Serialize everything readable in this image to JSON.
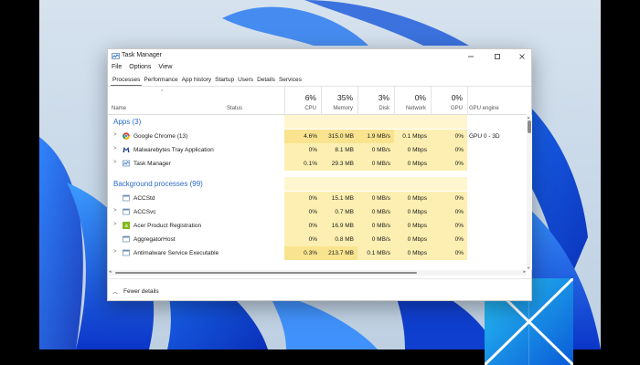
{
  "window": {
    "title": "Task Manager",
    "controls": {
      "minimize": "—",
      "maximize": "☐",
      "close": "✕"
    }
  },
  "menu": [
    "File",
    "Options",
    "View"
  ],
  "tabs": [
    {
      "label": "Processes",
      "active": true
    },
    {
      "label": "Performance",
      "active": false
    },
    {
      "label": "App history",
      "active": false
    },
    {
      "label": "Startup",
      "active": false
    },
    {
      "label": "Users",
      "active": false
    },
    {
      "label": "Details",
      "active": false
    },
    {
      "label": "Services",
      "active": false
    }
  ],
  "columns": {
    "name": "Name",
    "status": "Status",
    "cpu": {
      "pct": "6%",
      "label": "CPU"
    },
    "memory": {
      "pct": "35%",
      "label": "Memory"
    },
    "disk": {
      "pct": "3%",
      "label": "Disk"
    },
    "network": {
      "pct": "0%",
      "label": "Network"
    },
    "gpu": {
      "pct": "0%",
      "label": "GPU"
    },
    "gpu_engine": "GPU engine"
  },
  "groups": {
    "apps": "Apps (3)",
    "background": "Background processes (99)"
  },
  "apps": [
    {
      "name": "Google Chrome (13)",
      "icon": "chrome-icon",
      "cpu": "4.6%",
      "memory": "315.0 MB",
      "disk": "1.9 MB/s",
      "network": "0.1 Mbps",
      "gpu": "0%",
      "gpu_engine": "GPU 0 - 3D",
      "expandable": true
    },
    {
      "name": "Malwarebytes Tray Application",
      "icon": "malwarebytes-icon",
      "cpu": "0%",
      "memory": "8.1 MB",
      "disk": "0 MB/s",
      "network": "0 Mbps",
      "gpu": "0%",
      "gpu_engine": "",
      "expandable": true
    },
    {
      "name": "Task Manager",
      "icon": "task-manager-icon",
      "cpu": "0.1%",
      "memory": "29.3 MB",
      "disk": "0 MB/s",
      "network": "0 Mbps",
      "gpu": "0%",
      "gpu_engine": "",
      "expandable": true
    }
  ],
  "background": [
    {
      "name": "ACCStd",
      "icon": "app-window-icon",
      "cpu": "0%",
      "memory": "15.1 MB",
      "disk": "0 MB/s",
      "network": "0 Mbps",
      "gpu": "0%",
      "gpu_engine": "",
      "expandable": false
    },
    {
      "name": "ACCSvc",
      "icon": "app-window-icon",
      "cpu": "0%",
      "memory": "0.7 MB",
      "disk": "0 MB/s",
      "network": "0 Mbps",
      "gpu": "0%",
      "gpu_engine": "",
      "expandable": true
    },
    {
      "name": "Acer Product Registration",
      "icon": "acer-icon",
      "cpu": "0%",
      "memory": "16.9 MB",
      "disk": "0 MB/s",
      "network": "0 Mbps",
      "gpu": "0%",
      "gpu_engine": "",
      "expandable": true
    },
    {
      "name": "AggregatorHost",
      "icon": "app-window-icon",
      "cpu": "0%",
      "memory": "0.8 MB",
      "disk": "0 MB/s",
      "network": "0 Mbps",
      "gpu": "0%",
      "gpu_engine": "",
      "expandable": false
    },
    {
      "name": "Antimalware Service Executable",
      "icon": "shield-icon",
      "cpu": "0.3%",
      "memory": "213.7 MB",
      "disk": "0.1 MB/s",
      "network": "0 Mbps",
      "gpu": "0%",
      "gpu_engine": "",
      "expandable": true
    }
  ],
  "footer": {
    "fewer_details": "Fewer details"
  },
  "colors": {
    "group_header": "#2a6ac8",
    "heat_light": "#fff6cf",
    "heat_medium": "#fcefb1",
    "heat_strong": "#f9e38f"
  }
}
